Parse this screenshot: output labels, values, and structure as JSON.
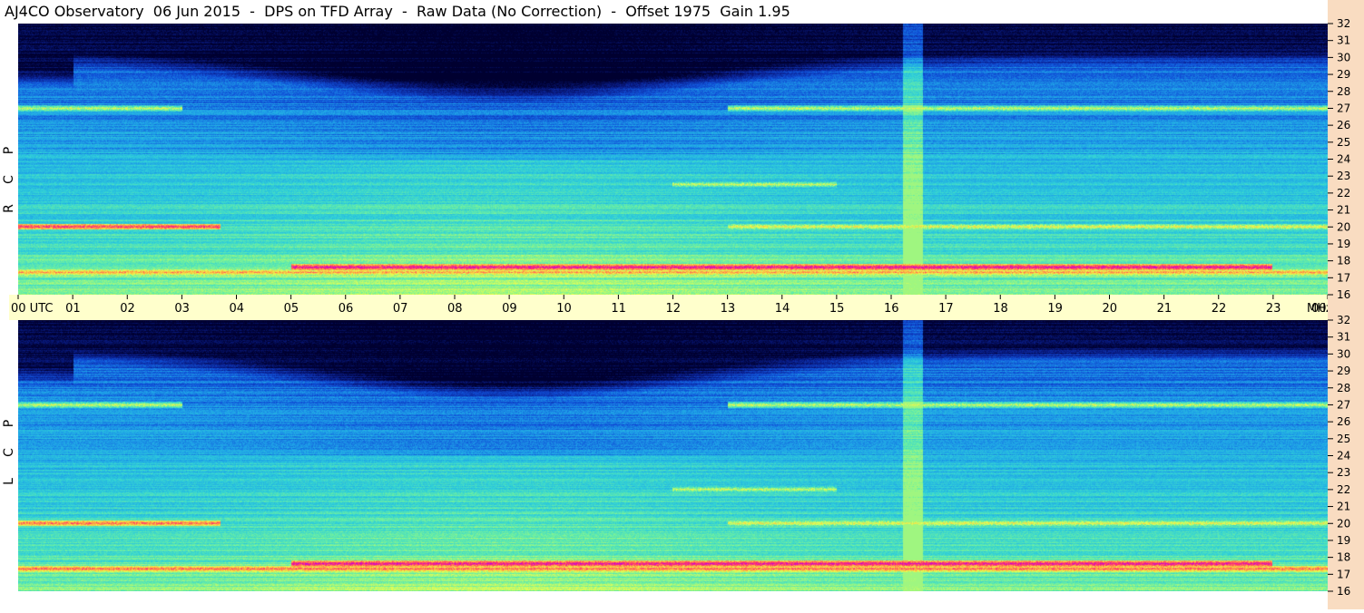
{
  "title": "AJ4CO Observatory  06 Jun 2015  -  DPS on TFD Array  -  Raw Data (No Correction)  -  Offset 1975  Gain 1.95",
  "colors": {
    "right_axis_bg": "#f9dcc1",
    "time_axis_bg": "#ffffcc",
    "colormap": [
      "#000030",
      "#0a1f8f",
      "#1050d8",
      "#1ea0e8",
      "#30d0d8",
      "#6ef0a0",
      "#e8ff50",
      "#ffb040",
      "#ff3070",
      "#c000e0"
    ]
  },
  "chart_data": [
    {
      "type": "heatmap",
      "panel": "RCP",
      "polarization_label": [
        "R",
        "C",
        "P"
      ],
      "x": {
        "unit": "UTC",
        "range": [
          "00",
          "00"
        ]
      },
      "y": {
        "unit": "MHz",
        "range": [
          16,
          32
        ],
        "ticks": [
          "16",
          "17",
          "18",
          "19",
          "20",
          "21",
          "22",
          "23",
          "24",
          "25",
          "26",
          "27",
          "28",
          "29",
          "30",
          "31",
          "32"
        ]
      },
      "features": [
        {
          "kind": "band",
          "freq_mhz": 17.3,
          "from_utc": 0,
          "to_utc": 24,
          "level": 0.8
        },
        {
          "kind": "band",
          "freq_mhz": 17.6,
          "from_utc": 5,
          "to_utc": 23,
          "level": 0.95
        },
        {
          "kind": "band",
          "freq_mhz": 20.0,
          "from_utc": 0,
          "to_utc": 3.7,
          "level": 0.9
        },
        {
          "kind": "band",
          "freq_mhz": 20.0,
          "from_utc": 13,
          "to_utc": 24,
          "level": 0.7
        },
        {
          "kind": "band",
          "freq_mhz": 22.5,
          "from_utc": 12,
          "to_utc": 15,
          "level": 0.65
        },
        {
          "kind": "band",
          "freq_mhz": 27.0,
          "from_utc": 0,
          "to_utc": 3,
          "level": 0.65
        },
        {
          "kind": "band",
          "freq_mhz": 27.0,
          "from_utc": 13,
          "to_utc": 24,
          "level": 0.65
        },
        {
          "kind": "vertical",
          "utc": 16.4,
          "level": 0.6
        }
      ]
    },
    {
      "type": "heatmap",
      "panel": "LCP",
      "polarization_label": [
        "L",
        "C",
        "P"
      ],
      "x": {
        "unit": "UTC",
        "range": [
          "00",
          "00"
        ]
      },
      "y": {
        "unit": "MHz",
        "range": [
          16,
          32
        ],
        "ticks": [
          "16",
          "17",
          "18",
          "19",
          "20",
          "21",
          "22",
          "23",
          "24",
          "25",
          "26",
          "27",
          "28",
          "29",
          "30",
          "31",
          "32"
        ]
      },
      "features": [
        {
          "kind": "band",
          "freq_mhz": 17.3,
          "from_utc": 0,
          "to_utc": 24,
          "level": 0.85
        },
        {
          "kind": "band",
          "freq_mhz": 17.6,
          "from_utc": 5,
          "to_utc": 23,
          "level": 0.95
        },
        {
          "kind": "band",
          "freq_mhz": 20.0,
          "from_utc": 0,
          "to_utc": 3.7,
          "level": 0.85
        },
        {
          "kind": "band",
          "freq_mhz": 20.0,
          "from_utc": 13,
          "to_utc": 24,
          "level": 0.7
        },
        {
          "kind": "band",
          "freq_mhz": 22.0,
          "from_utc": 12,
          "to_utc": 15,
          "level": 0.65
        },
        {
          "kind": "band",
          "freq_mhz": 27.0,
          "from_utc": 0,
          "to_utc": 3,
          "level": 0.65
        },
        {
          "kind": "band",
          "freq_mhz": 27.0,
          "from_utc": 13,
          "to_utc": 24,
          "level": 0.65
        },
        {
          "kind": "vertical",
          "utc": 16.4,
          "level": 0.6
        }
      ]
    }
  ],
  "time_axis": {
    "labels": [
      "00  UTC",
      "01",
      "02",
      "03",
      "04",
      "05",
      "06",
      "07",
      "08",
      "09",
      "10",
      "11",
      "12",
      "13",
      "14",
      "15",
      "16",
      "17",
      "18",
      "19",
      "20",
      "21",
      "22",
      "23",
      "00"
    ],
    "unit_label": "MHz"
  }
}
